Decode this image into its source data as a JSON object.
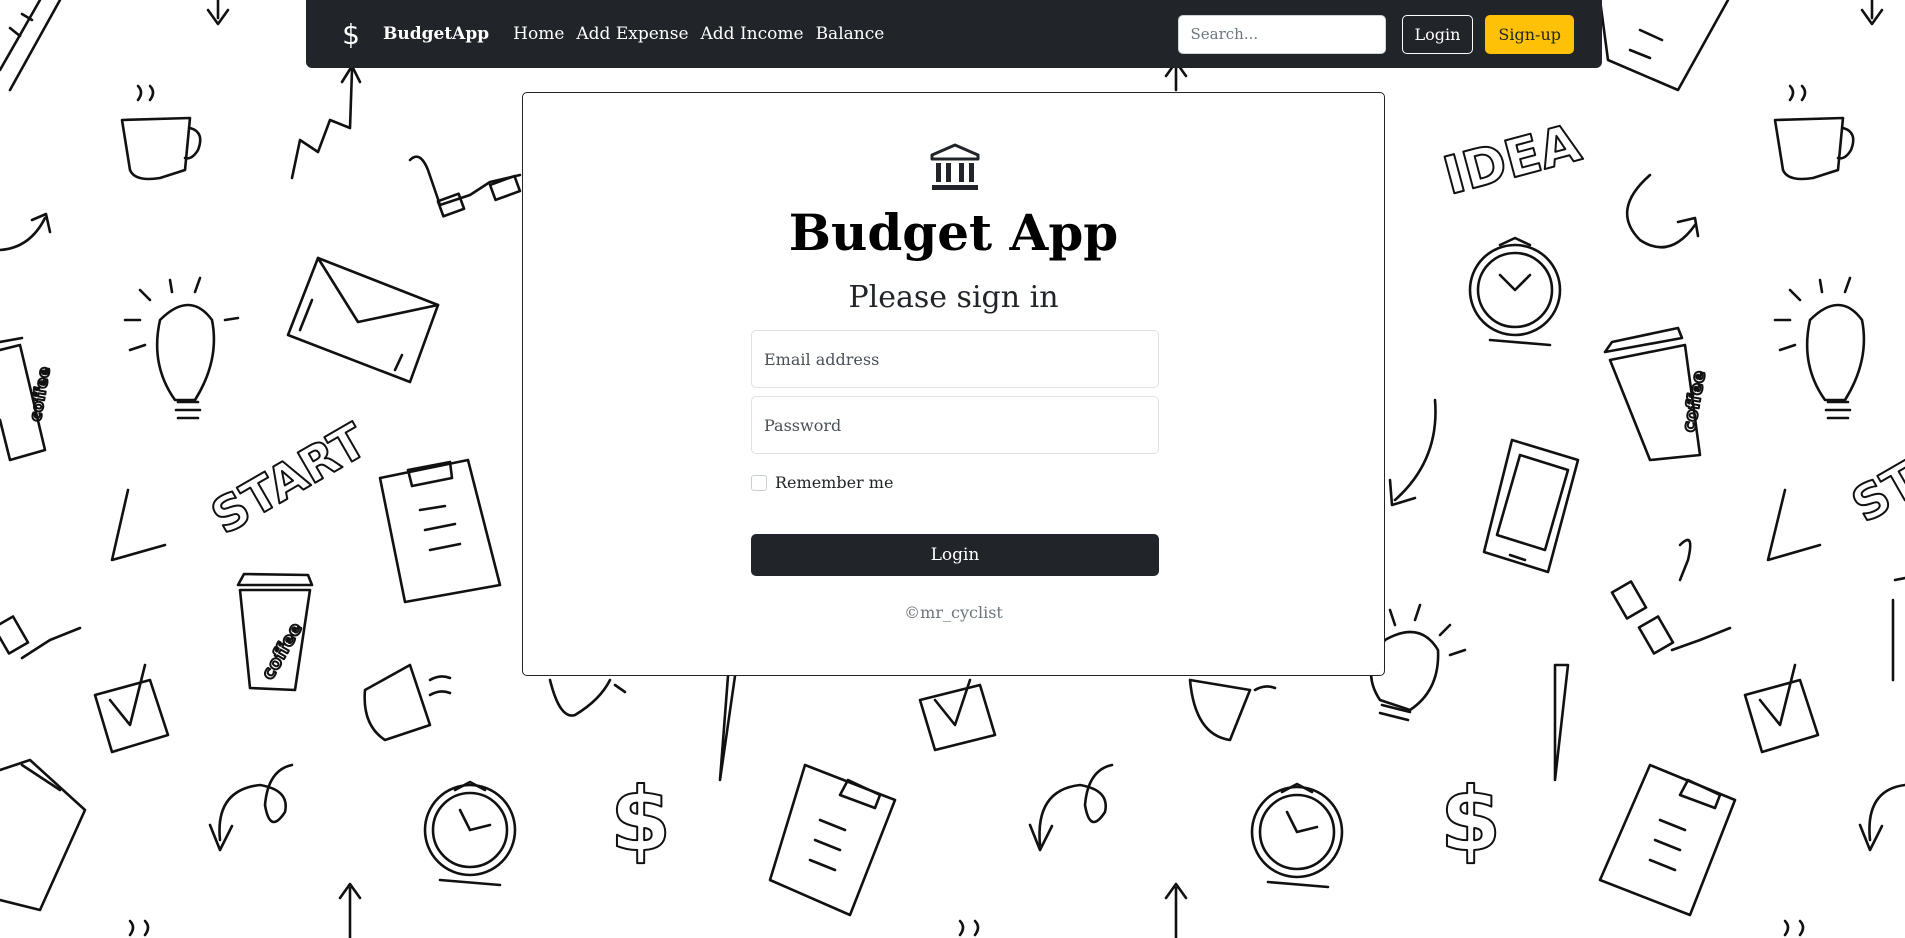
{
  "navbar": {
    "brand_icon": "$",
    "brand_name": "BudgetApp",
    "links": [
      "Home",
      "Add Expense",
      "Add Income",
      "Balance"
    ],
    "search_placeholder": "Search...",
    "login_label": "Login",
    "signup_label": "Sign-up"
  },
  "card": {
    "icon": "bank-icon",
    "title": "Budget App",
    "subtitle": "Please sign in",
    "email_placeholder": "Email address",
    "password_placeholder": "Password",
    "remember_label": "Remember me",
    "submit_label": "Login",
    "copyright": "©mr_cyclist"
  },
  "background": {
    "doodle_words": [
      "START",
      "IDEA",
      "coffee",
      "$"
    ]
  },
  "colors": {
    "navbar": "#212529",
    "signup": "#ffc107",
    "submit": "#212529"
  }
}
